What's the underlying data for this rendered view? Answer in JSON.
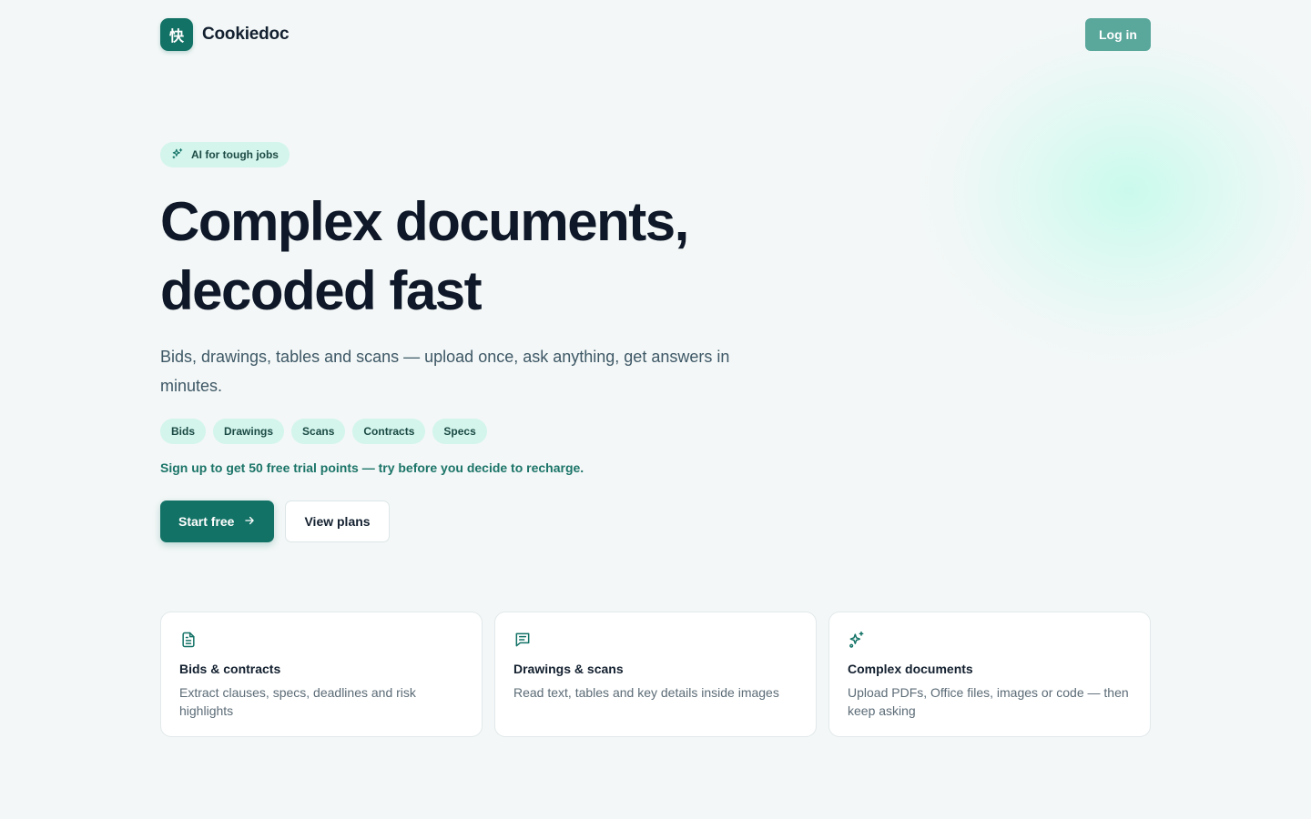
{
  "header": {
    "logo_glyph": "快",
    "brand_name": "Cookiedoc",
    "login_label": "Log in"
  },
  "hero": {
    "badge": "AI for tough jobs",
    "headline_line1": "Complex documents,",
    "headline_line2": "decoded fast",
    "subtitle": "Bids, drawings, tables and scans — upload once, ask anything, get answers in minutes.",
    "tags": [
      "Bids",
      "Drawings",
      "Scans",
      "Contracts",
      "Specs"
    ],
    "promo": "Sign up to get 50 free trial points — try before you decide to recharge.",
    "primary_cta": "Start free",
    "secondary_cta": "View plans"
  },
  "features": [
    {
      "icon": "document-icon",
      "title": "Bids & contracts",
      "desc": "Extract clauses, specs, deadlines and risk highlights"
    },
    {
      "icon": "message-lines-icon",
      "title": "Drawings & scans",
      "desc": "Read text, tables and key details inside images"
    },
    {
      "icon": "sparkles-icon",
      "title": "Complex documents",
      "desc": "Upload PDFs, Office files, images or code — then keep asking"
    }
  ],
  "colors": {
    "brand": "#137266",
    "login": "#5aa79c",
    "tag_bg": "#d3f5ec",
    "background": "#f3f7f7"
  }
}
